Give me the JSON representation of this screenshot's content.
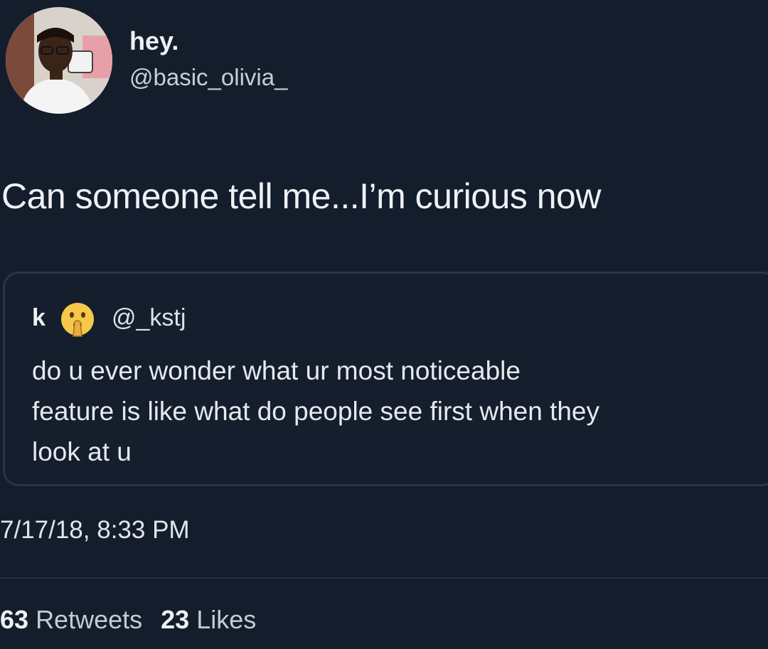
{
  "author": {
    "display_name": "hey.",
    "handle": "@basic_olivia_",
    "avatar_icon": "profile-photo"
  },
  "tweet": {
    "text": "Can someone tell me...I’m curious now",
    "timestamp": "7/17/18, 8:33 PM"
  },
  "quoted_tweet": {
    "display_name": "k",
    "emoji_icon": "shushing-face-emoji",
    "handle": "@_kstj",
    "text": "do u ever wonder what ur most noticeable\nfeature is like what do people see first when they\nlook at u"
  },
  "stats": {
    "retweets_count": "63",
    "retweets_label": "Retweets",
    "likes_count": "23",
    "likes_label": "Likes"
  },
  "colors": {
    "background": "#141d2c",
    "text": "#eef1f4",
    "border": "#2a3446"
  }
}
